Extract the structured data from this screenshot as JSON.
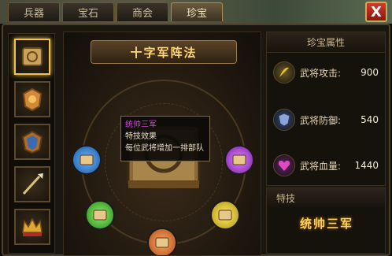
{
  "tabs": [
    {
      "label": "兵器",
      "active": false
    },
    {
      "label": "宝石",
      "active": false
    },
    {
      "label": "商会",
      "active": false
    },
    {
      "label": "珍宝",
      "active": true
    }
  ],
  "close_label": "X",
  "treasure": {
    "title": "十字军阵法",
    "items": [
      {
        "icon": "scroll-book-icon",
        "active": true
      },
      {
        "icon": "lion-crest-icon",
        "active": false
      },
      {
        "icon": "armor-crest-icon",
        "active": false
      },
      {
        "icon": "spear-icon",
        "active": false
      },
      {
        "icon": "crown-icon",
        "active": false
      }
    ],
    "orbs": [
      {
        "icon": "blue-book-icon",
        "color": "#2a8be0"
      },
      {
        "icon": "purple-book-icon",
        "color": "#b03ad0"
      },
      {
        "icon": "green-book-icon",
        "color": "#4fc030"
      },
      {
        "icon": "yellow-book-icon",
        "color": "#e0c020"
      },
      {
        "icon": "orange-book-icon",
        "color": "#e06a20"
      }
    ]
  },
  "tooltip": {
    "title": "统帅三军",
    "line1": "特技效果",
    "line2": "每位武将增加一排部队"
  },
  "attributes": {
    "header": "珍宝属性",
    "rows": [
      {
        "label": "武将攻击:",
        "value": "900",
        "icon": "attack-icon",
        "color": "#f0c030"
      },
      {
        "label": "武将防御:",
        "value": "540",
        "icon": "shield-icon",
        "color": "#5a7ab0"
      },
      {
        "label": "武将血量:",
        "value": "1440",
        "icon": "heart-icon",
        "color": "#c040b0"
      }
    ]
  },
  "skill": {
    "header": "特技",
    "name": "统帅三军"
  },
  "colors": {
    "accent_gold": "#ffd77a",
    "tooltip_title": "#d04ad8",
    "close_red": "#d23b2a"
  }
}
